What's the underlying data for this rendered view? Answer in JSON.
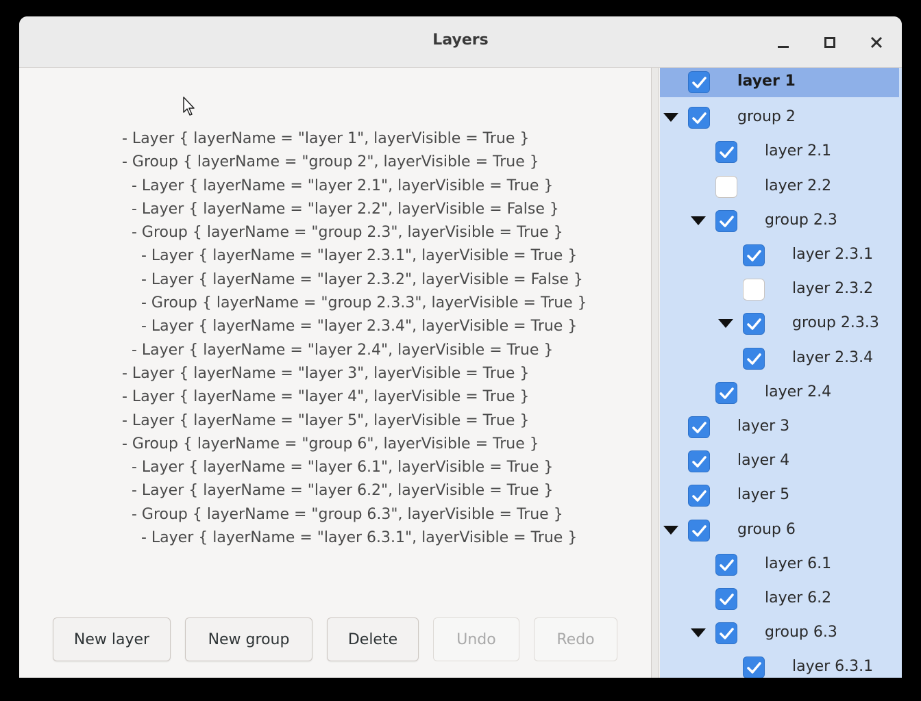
{
  "window": {
    "title": "Layers"
  },
  "text_tree": [
    "- Layer { layerName = \"layer 1\", layerVisible = True }",
    "- Group { layerName = \"group 2\", layerVisible = True }",
    "  - Layer { layerName = \"layer 2.1\", layerVisible = True }",
    "  - Layer { layerName = \"layer 2.2\", layerVisible = False }",
    "  - Group { layerName = \"group 2.3\", layerVisible = True }",
    "    - Layer { layerName = \"layer 2.3.1\", layerVisible = True }",
    "    - Layer { layerName = \"layer 2.3.2\", layerVisible = False }",
    "    - Group { layerName = \"group 2.3.3\", layerVisible = True }",
    "    - Layer { layerName = \"layer 2.3.4\", layerVisible = True }",
    "  - Layer { layerName = \"layer 2.4\", layerVisible = True }",
    "- Layer { layerName = \"layer 3\", layerVisible = True }",
    "- Layer { layerName = \"layer 4\", layerVisible = True }",
    "- Layer { layerName = \"layer 5\", layerVisible = True }",
    "- Group { layerName = \"group 6\", layerVisible = True }",
    "  - Layer { layerName = \"layer 6.1\", layerVisible = True }",
    "  - Layer { layerName = \"layer 6.2\", layerVisible = True }",
    "  - Group { layerName = \"group 6.3\", layerVisible = True }",
    "    - Layer { layerName = \"layer 6.3.1\", layerVisible = True }"
  ],
  "buttons": {
    "new_layer": "New layer",
    "new_group": "New group",
    "delete": "Delete",
    "undo": "Undo",
    "redo": "Redo"
  },
  "layer_tree": [
    {
      "label": "layer 1",
      "level": 0,
      "checked": true,
      "expandable": false,
      "selected": true
    },
    {
      "label": "group 2",
      "level": 0,
      "checked": true,
      "expandable": true,
      "selected": false
    },
    {
      "label": "layer 2.1",
      "level": 1,
      "checked": true,
      "expandable": false,
      "selected": false
    },
    {
      "label": "layer 2.2",
      "level": 1,
      "checked": false,
      "expandable": false,
      "selected": false
    },
    {
      "label": "group 2.3",
      "level": 1,
      "checked": true,
      "expandable": true,
      "selected": false
    },
    {
      "label": "layer 2.3.1",
      "level": 2,
      "checked": true,
      "expandable": false,
      "selected": false
    },
    {
      "label": "layer 2.3.2",
      "level": 2,
      "checked": false,
      "expandable": false,
      "selected": false
    },
    {
      "label": "group 2.3.3",
      "level": 2,
      "checked": true,
      "expandable": true,
      "selected": false
    },
    {
      "label": "layer 2.3.4",
      "level": 2,
      "checked": true,
      "expandable": false,
      "selected": false
    },
    {
      "label": "layer 2.4",
      "level": 1,
      "checked": true,
      "expandable": false,
      "selected": false
    },
    {
      "label": "layer 3",
      "level": 0,
      "checked": true,
      "expandable": false,
      "selected": false
    },
    {
      "label": "layer 4",
      "level": 0,
      "checked": true,
      "expandable": false,
      "selected": false
    },
    {
      "label": "layer 5",
      "level": 0,
      "checked": true,
      "expandable": false,
      "selected": false
    },
    {
      "label": "group 6",
      "level": 0,
      "checked": true,
      "expandable": true,
      "selected": false
    },
    {
      "label": "layer 6.1",
      "level": 1,
      "checked": true,
      "expandable": false,
      "selected": false
    },
    {
      "label": "layer 6.2",
      "level": 1,
      "checked": true,
      "expandable": false,
      "selected": false
    },
    {
      "label": "group 6.3",
      "level": 1,
      "checked": true,
      "expandable": true,
      "selected": false
    },
    {
      "label": "layer 6.3.1",
      "level": 2,
      "checked": true,
      "expandable": false,
      "selected": false
    }
  ],
  "colors": {
    "checkbox_on": "#3a86e6",
    "tree_background": "#cfe0f7",
    "selected_row": "#8eb0e8"
  }
}
